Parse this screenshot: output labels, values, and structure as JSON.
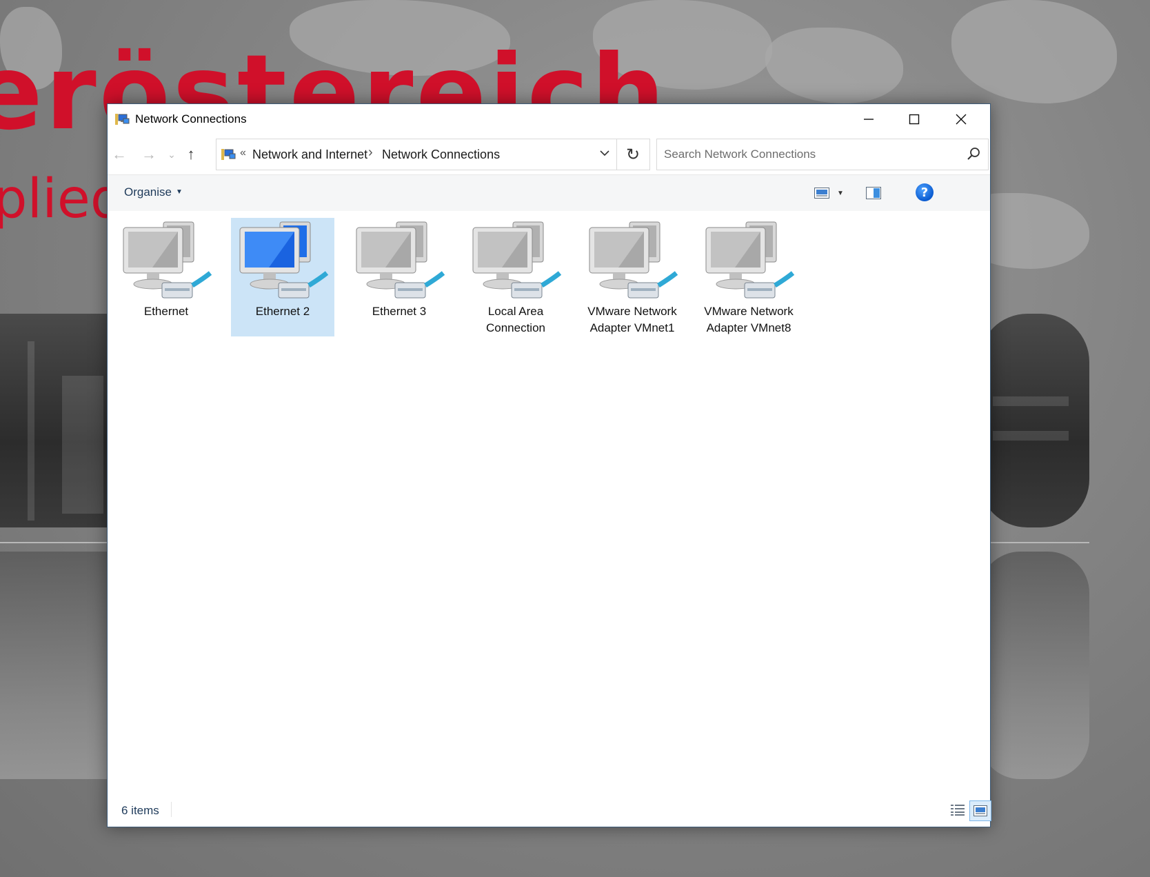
{
  "window": {
    "title": "Network Connections"
  },
  "toolbar": {
    "back_label": "←",
    "forward_label": "→",
    "recent_label": "⌄",
    "up_label": "↑",
    "refresh_label": "↻"
  },
  "address": {
    "overflow": "«",
    "crumbs": [
      "Network and Internet",
      "Network Connections"
    ],
    "separator": "›"
  },
  "search": {
    "placeholder": "Search Network Connections"
  },
  "command_bar": {
    "organise_label": "Organise"
  },
  "items": [
    {
      "label_line1": "Ethernet",
      "label_line2": "",
      "selected": false
    },
    {
      "label_line1": "Ethernet 2",
      "label_line2": "",
      "selected": true
    },
    {
      "label_line1": "Ethernet 3",
      "label_line2": "",
      "selected": false
    },
    {
      "label_line1": "Local Area",
      "label_line2": "Connection",
      "selected": false
    },
    {
      "label_line1": "VMware Network",
      "label_line2": "Adapter VMnet1",
      "selected": false
    },
    {
      "label_line1": "VMware Network",
      "label_line2": "Adapter VMnet8",
      "selected": false
    }
  ],
  "status": {
    "count_text": "6 items"
  },
  "colors": {
    "selection": "#cce4f7",
    "brand_red": "#d0102a",
    "help_blue": "#0a5bd0"
  },
  "wallpaper": {
    "brand_text": "eröstereich",
    "brand_sub": "plied"
  }
}
